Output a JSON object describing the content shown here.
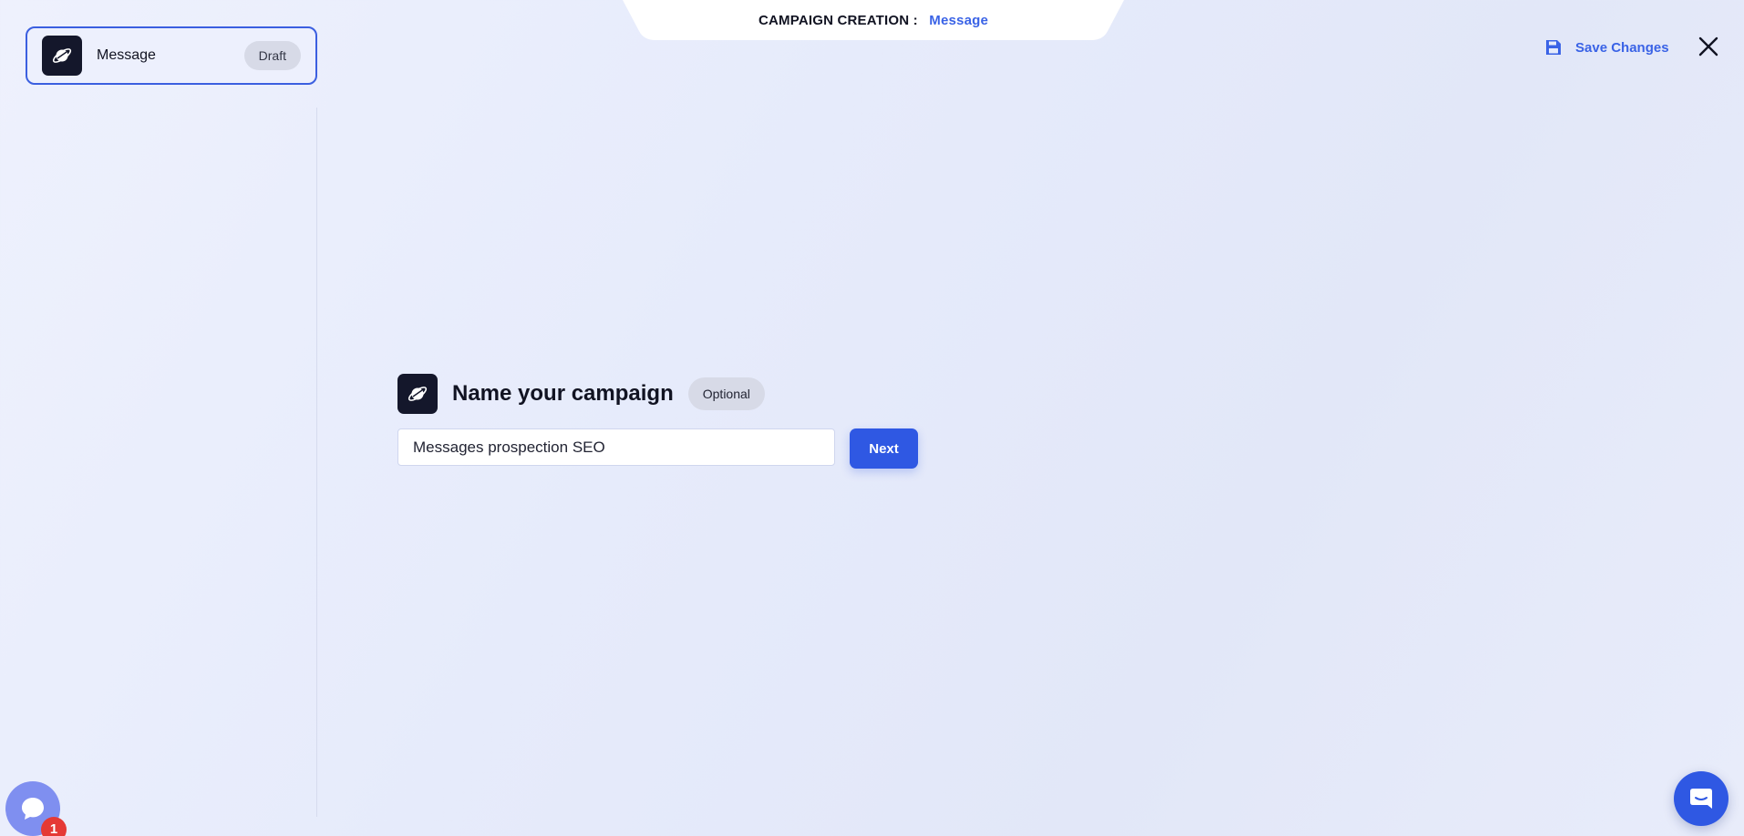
{
  "header": {
    "prefix": "CAMPAIGN CREATION :",
    "campaign_name": "Message"
  },
  "campaign_card": {
    "title": "Message",
    "status": "Draft",
    "icon": "planet-icon"
  },
  "actions": {
    "save_label": "Save Changes",
    "save_icon": "floppy-disk-icon",
    "close_icon": "close-icon"
  },
  "form": {
    "title": "Name your campaign",
    "optional_label": "Optional",
    "input_value": "Messages prospection SEO",
    "next_label": "Next",
    "icon": "planet-icon"
  },
  "widgets": {
    "left_chat_icon": "chat-bubble-icon",
    "notification_count": "1",
    "right_chat_icon": "intercom-chat-icon"
  },
  "colors": {
    "accent": "#3a63e6",
    "button": "#2f58e3",
    "dark": "#14172b",
    "badge_bg": "#d7dae7",
    "notification": "#e53935"
  }
}
